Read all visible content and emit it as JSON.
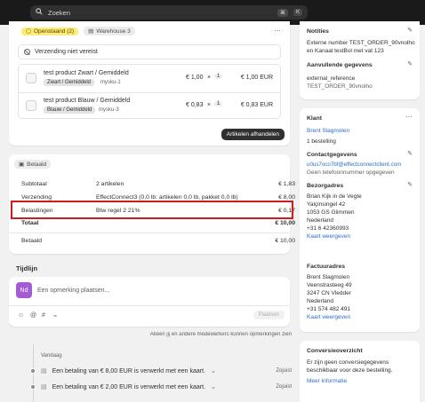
{
  "search": {
    "placeholder": "Zoeken",
    "shortcut_cmd": "⌘",
    "shortcut_key": "K"
  },
  "fulfillment": {
    "status_badge": "Openstaand (2)",
    "location_badge": "Warehouse 3",
    "shipping_note": "Verzending niet vereist",
    "items": [
      {
        "name": "test product Zwart / Gemiddeld",
        "variant": "Zwart / Gemiddeld",
        "sku": "mysku-1",
        "price": "€ 1,00",
        "times": "×",
        "qty": "1",
        "total": "€ 1,00 EUR"
      },
      {
        "name": "test product Blauw / Gemiddeld",
        "variant": "Blauw / Gemiddeld",
        "sku": "mysku-3",
        "price": "€ 0,83",
        "times": "×",
        "qty": "1",
        "total": "€ 0,83 EUR"
      }
    ],
    "fulfill_button": "Artikelen afhandelen"
  },
  "payment": {
    "badge": "Betaald",
    "rows": [
      {
        "label": "Subtotaal",
        "desc": "2 artikelen",
        "amount": "€ 1,83"
      },
      {
        "label": "Verzending",
        "desc": "EffectConnect3 (0,0 lb: artikelen 0,0 lb, pakket 0,0 lb)",
        "amount": "€ 8,00"
      },
      {
        "label": "Belastingen",
        "desc": "Btw regel 2 21%",
        "amount": "€ 0,17"
      },
      {
        "label": "Totaal",
        "desc": "",
        "amount": "€ 10,00"
      }
    ],
    "paid_label": "Betaald",
    "paid_amount": "€ 10,00"
  },
  "timeline": {
    "title": "Tijdlijn",
    "avatar": "Nd",
    "comment_placeholder": "Een opmerking plaatsen...",
    "post_button": "Plaatsen",
    "visibility_note": "Alleen jij en andere medewerkers kunnen opmerkingen zien",
    "day": "Vandaag",
    "events": [
      {
        "text": "Een betaling van € 8,00 EUR is verwerkt met een kaart.",
        "time": "Zojuist"
      },
      {
        "text": "Een betaling van € 2,00 EUR is verwerkt met een kaart.",
        "time": "Zojuist"
      }
    ]
  },
  "sidebar": {
    "notes": {
      "title": "Notities",
      "text": "Externe number TEST_ORDER_90vnolho en Kanaal testBol met vat 123"
    },
    "additional": {
      "title": "Aanvullende gegevens",
      "key": "external_reference",
      "value": "TEST_ORDER_90vnolho"
    },
    "customer": {
      "title": "Klant",
      "name": "Brent Slagmolen",
      "orders": "1 bestelling",
      "contact_title": "Contactgegevens",
      "email": "u0us7oco7bf@effectconnectclient.com",
      "phone": "Geen telefoonnummer opgegeven",
      "shipping_title": "Bezorgadres",
      "shipping_lines": [
        "Brian Kijk in de Vegte",
        "Yalçinsingel 42",
        "1053 GS Glimmen",
        "Nederland",
        "+31 6 42360993"
      ],
      "map_link": "Kaart weergeven",
      "billing_title": "Factuuradres",
      "billing_lines": [
        "Brent Slagmolen",
        "Veenstrasteeg 49",
        "3247 CN Vledder",
        "Nederland",
        "+31 574 482 491"
      ],
      "map_link2": "Kaart weergeven"
    },
    "conversion": {
      "title": "Conversieoverzicht",
      "text": "Er zijn geen conversiegegevens beschikbaar voor deze bestelling.",
      "link": "Meer informatie"
    }
  },
  "colors": {
    "highlight": "#d11a1a",
    "status_badge_bg": "#ffeb78",
    "link": "#2c6ecb"
  }
}
